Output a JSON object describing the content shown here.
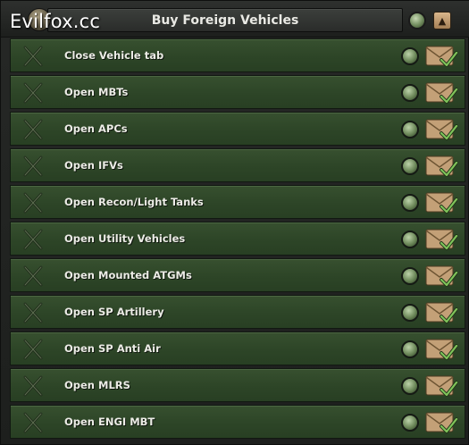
{
  "watermark": "Evilfox.cc",
  "header": {
    "title": "Buy Foreign Vehicles",
    "collapse_icon": "chevron-up-icon"
  },
  "colors": {
    "row_green": "#2d4527",
    "header_dark": "#2a2c2a",
    "text": "#ecece6",
    "button_tan": "#c3a077"
  },
  "rows": [
    {
      "label": "Close Vehicle tab",
      "icon": "crossed-rifles-icon"
    },
    {
      "label": "Open MBTs",
      "icon": "crossed-rifles-icon"
    },
    {
      "label": "Open APCs",
      "icon": "crossed-rifles-icon"
    },
    {
      "label": "Open IFVs",
      "icon": "crossed-rifles-icon"
    },
    {
      "label": "Open Recon/Light Tanks",
      "icon": "crossed-rifles-icon"
    },
    {
      "label": "Open Utility Vehicles",
      "icon": "crossed-rifles-icon"
    },
    {
      "label": "Open Mounted ATGMs",
      "icon": "crossed-rifles-icon"
    },
    {
      "label": "Open SP Artillery",
      "icon": "crossed-rifles-icon"
    },
    {
      "label": "Open SP Anti Air",
      "icon": "crossed-rifles-icon"
    },
    {
      "label": "Open MLRS",
      "icon": "crossed-rifles-icon"
    },
    {
      "label": "Open ENGI MBT",
      "icon": "crossed-rifles-icon"
    }
  ]
}
